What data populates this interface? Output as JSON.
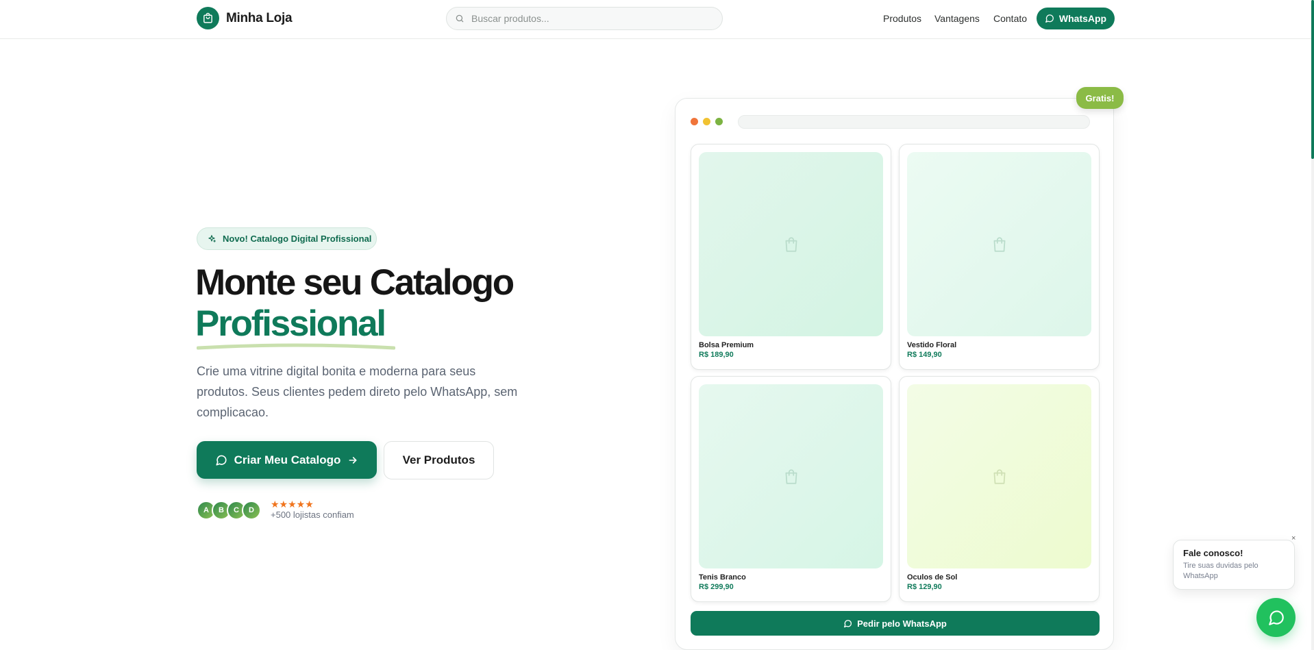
{
  "header": {
    "brand": "Minha Loja",
    "search_placeholder": "Buscar produtos...",
    "nav": [
      "Produtos",
      "Vantagens",
      "Contato"
    ],
    "whatsapp_label": "WhatsApp"
  },
  "hero": {
    "badge": "Novo! Catalogo Digital Profissional",
    "title_line1": "Monte seu Catalogo",
    "title_line2": "Profissional",
    "description": "Crie uma vitrine digital bonita e moderna para seus produtos. Seus clientes pedem direto pelo WhatsApp, sem complicacao.",
    "cta_primary": "Criar Meu Catalogo",
    "cta_secondary": "Ver Produtos",
    "avatars": [
      "A",
      "B",
      "C",
      "D"
    ],
    "rating_stars": 5,
    "stars_glyphs": "★★★★★",
    "trust_text": "+500 lojistas confiam"
  },
  "mockup": {
    "badge": "Gratis!",
    "products": [
      {
        "name": "Bolsa Premium",
        "price": "R$ 189,90"
      },
      {
        "name": "Vestido Floral",
        "price": "R$ 149,90"
      },
      {
        "name": "Tenis Branco",
        "price": "R$ 299,90"
      },
      {
        "name": "Oculos de Sol",
        "price": "R$ 129,90"
      }
    ],
    "order_button": "Pedir pelo WhatsApp"
  },
  "chat": {
    "title": "Fale conosco!",
    "subtitle": "Tire suas duvidas pelo WhatsApp",
    "close": "×"
  },
  "colors": {
    "brand": "#0f7a5a",
    "accent_green": "#8bbb46",
    "whatsapp_green": "#21c15e",
    "star": "#f0741d"
  },
  "icons": {
    "logo": "shopping-bag-icon",
    "search": "search-icon",
    "whatsapp": "message-circle-icon",
    "sparkle": "sparkles-icon",
    "arrow": "arrow-right-icon",
    "product_placeholder": "shopping-bag-icon",
    "close": "close-icon"
  }
}
